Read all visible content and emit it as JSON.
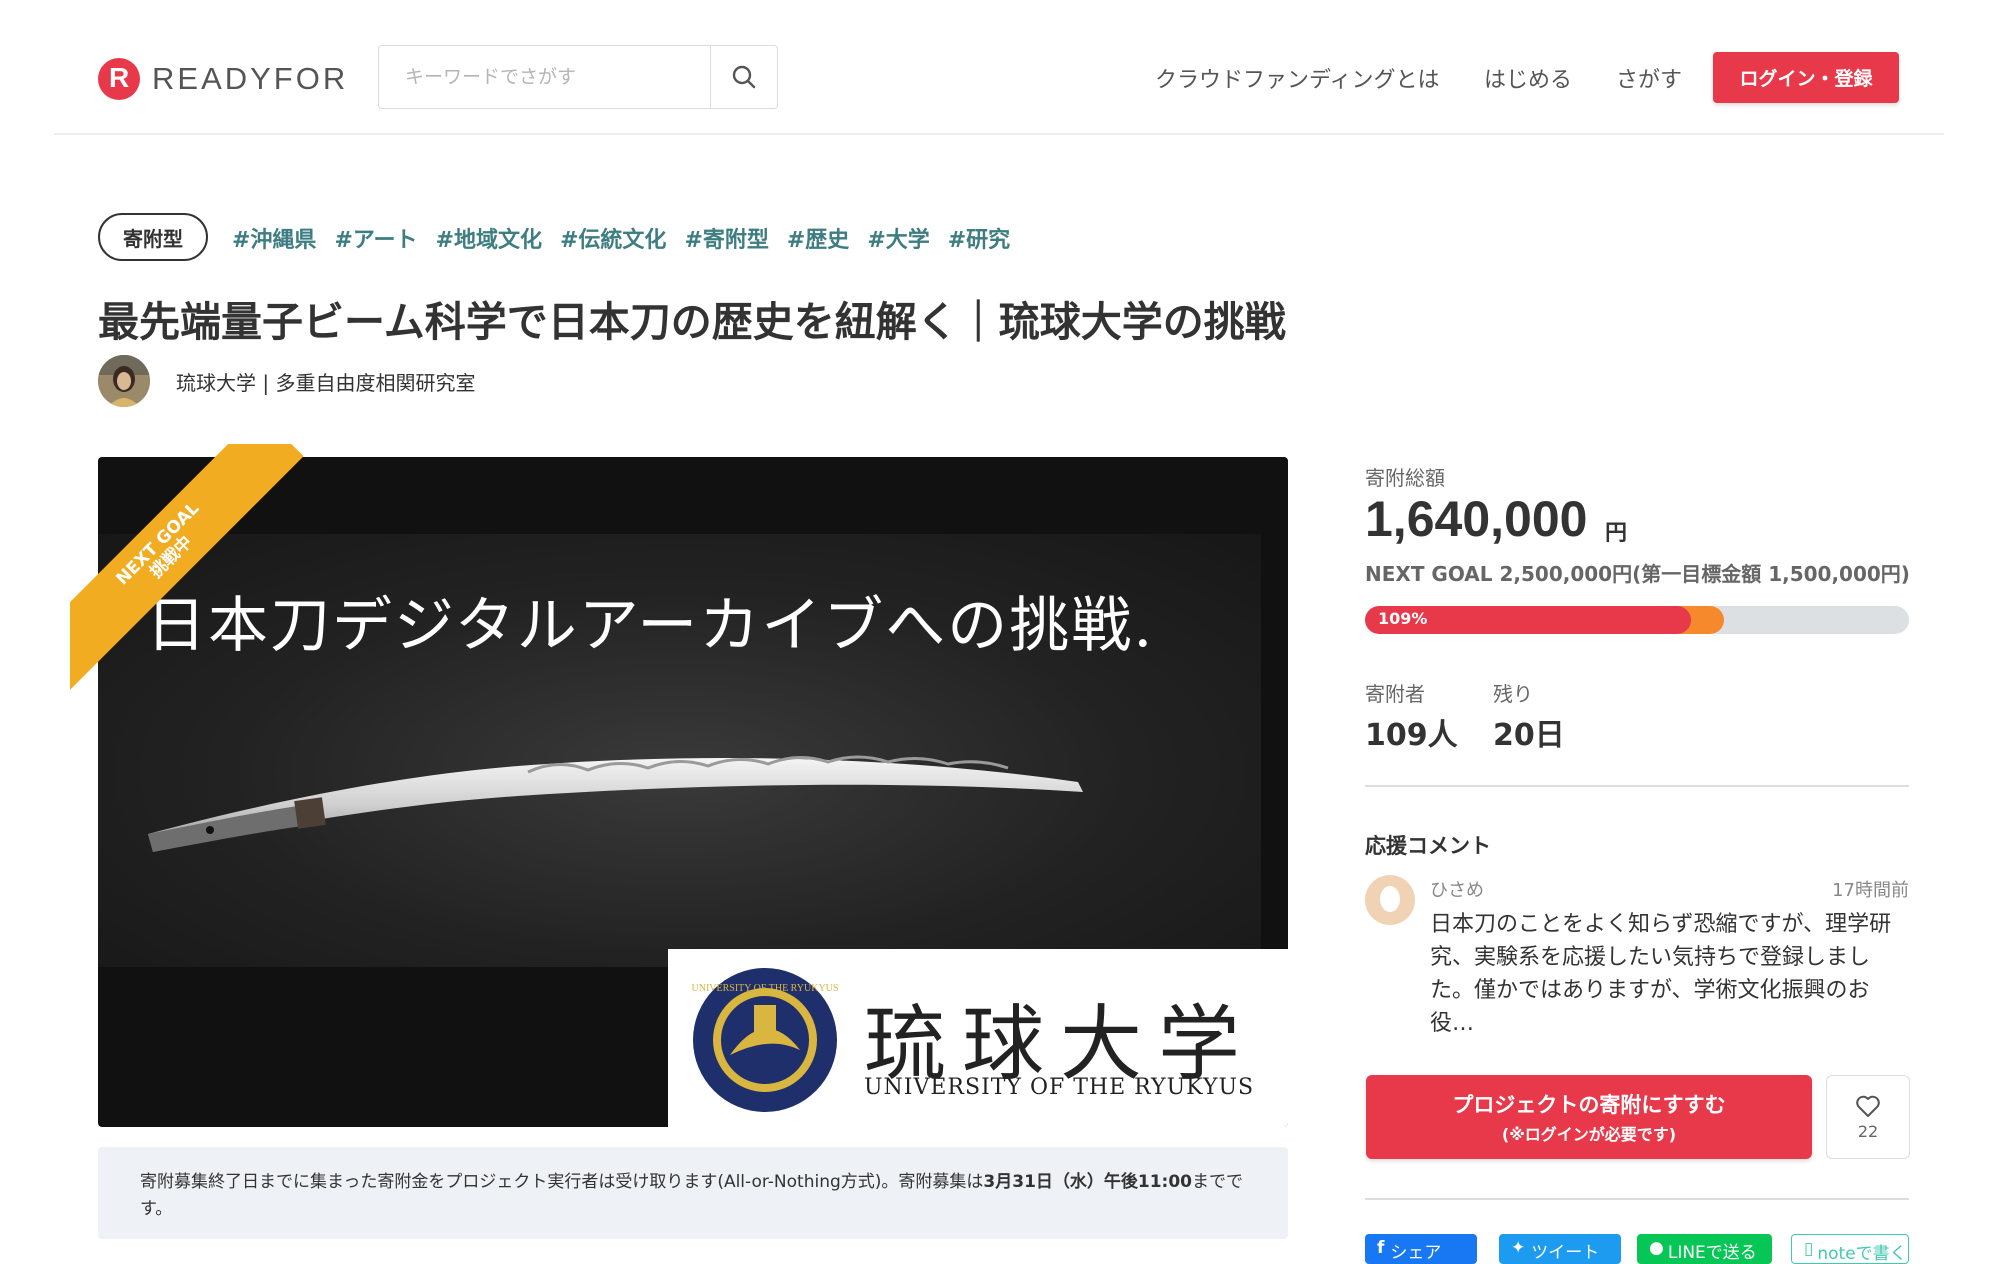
{
  "header": {
    "logo_text": "READYFOR",
    "logo_mark": "R",
    "search_placeholder": "キーワードでさがす",
    "nav": [
      "クラウドファンディングとは",
      "はじめる",
      "さがす"
    ],
    "login_label": "ログイン・登録"
  },
  "project": {
    "type_tag": "寄附型",
    "tags": [
      "#沖縄県",
      "#アート",
      "#地域文化",
      "#伝統文化",
      "#寄附型",
      "#歴史",
      "#大学",
      "#研究"
    ],
    "title": "最先端量子ビーム科学で日本刀の歴史を紐解く｜琉球大学の挑戦",
    "owner": "琉球大学 | 多重自由度相関研究室"
  },
  "hero": {
    "ribbon_line1": "NEXT GOAL",
    "ribbon_line2": "挑戦中",
    "headline": "日本刀デジタルアーカイブへの挑戦.",
    "univ_jp": "琉球大学",
    "univ_en": "UNIVERSITY OF THE RYUKYUS"
  },
  "notice": {
    "text_before": "寄附募集終了日までに集まった寄附金をプロジェクト実行者は受け取ります(All-or-Nothing方式)。寄附募集は",
    "deadline": "3月31日（水）午後11:00",
    "text_after": "までです。"
  },
  "stats": {
    "total_label": "寄附総額",
    "total_amount": "1,640,000",
    "total_unit": "円",
    "next_goal": "NEXT GOAL 2,500,000円(第一目標金額 1,500,000円)",
    "progress_label": "109%",
    "progress_red_fraction": 0.6,
    "progress_orange_fraction": 0.66,
    "supporters_label": "寄附者",
    "supporters_value": "109人",
    "remaining_label": "残り",
    "remaining_value": "20日"
  },
  "comments": {
    "title": "応援コメント",
    "items": [
      {
        "name": "ひさめ",
        "time": "17時間前",
        "text": "日本刀のことをよく知らず恐縮ですが、理学研究、実験系を応援したい気持ちで登録しました。僅かではありますが、学術文化振興のお役…"
      }
    ]
  },
  "actions": {
    "support_label": "プロジェクトの寄附にすすむ",
    "support_sub": "(※ログインが必要です)",
    "favorite_count": "22"
  },
  "share": {
    "facebook": "シェア",
    "twitter": "ツイート",
    "line": "LINEで送る",
    "note": "noteで書く"
  },
  "colors": {
    "brand_red": "#e8394b",
    "tag_teal": "#3e7d81",
    "ribbon_yellow": "#f2ac22",
    "progress_orange": "#f7892d"
  }
}
